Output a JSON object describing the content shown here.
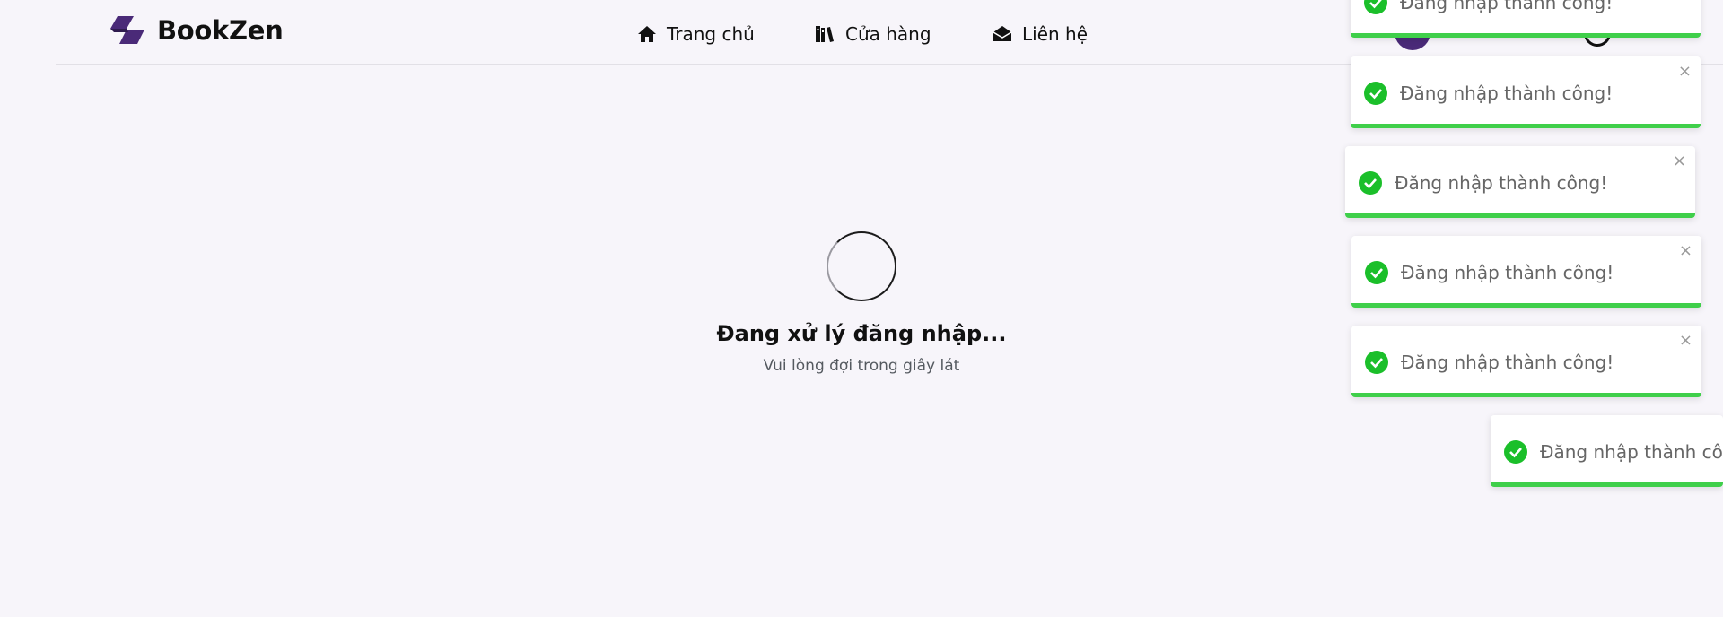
{
  "brand": {
    "name": "BookZen",
    "color": "#4a2a78"
  },
  "nav": {
    "home": {
      "label": "Trang chủ",
      "icon": "home-icon"
    },
    "shop": {
      "label": "Cửa hàng",
      "icon": "books-icon"
    },
    "contact": {
      "label": "Liên hệ",
      "icon": "envelope-open-icon"
    }
  },
  "loader": {
    "title": "Đang xử lý đăng nhập...",
    "subtitle": "Vui lòng đợi trong giây lát"
  },
  "toasts": [
    {
      "message": "Đăng nhập thành công!",
      "close": "×"
    },
    {
      "message": "Đăng nhập thành công!",
      "close": "×"
    },
    {
      "message": "Đăng nhập thành công!",
      "close": "×"
    },
    {
      "message": "Đăng nhập thành công!",
      "close": "×"
    },
    {
      "message": "Đăng nhập thành công!",
      "close": "×"
    },
    {
      "message": "Đăng nhập thành công!",
      "close": "×"
    }
  ],
  "colors": {
    "success": "#3fcf4a",
    "check": "#1bbf2a",
    "background": "#f7f5fa"
  }
}
